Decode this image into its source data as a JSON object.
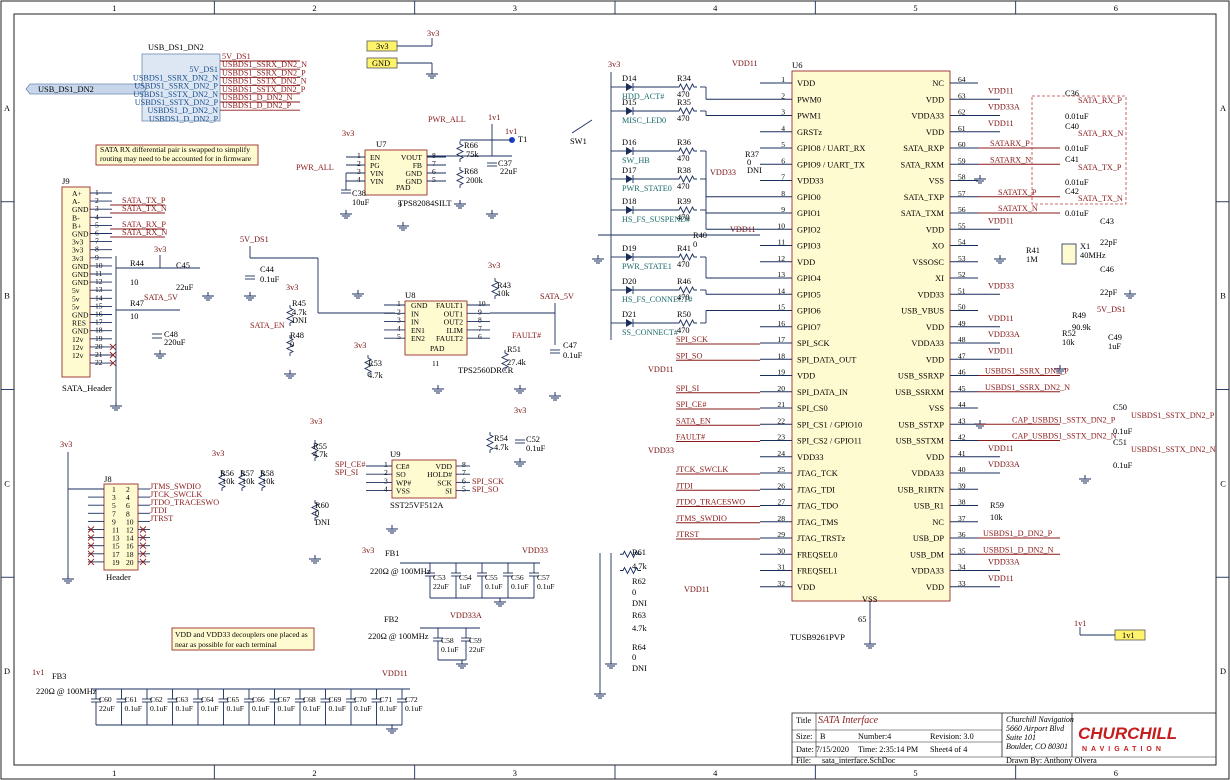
{
  "frame": {
    "col_labels": [
      "1",
      "2",
      "3",
      "4",
      "5",
      "6"
    ],
    "row_labels": [
      "A",
      "B",
      "C",
      "D"
    ]
  },
  "notes": {
    "sata_rx": [
      "SATA RX differential pair is swapped to simplify",
      "routing may need to be accounted for in firmware"
    ],
    "decoupling": [
      "VDD and VDD33 decouplers one placed as",
      "near as possible for each terminal"
    ]
  },
  "usb_harness": {
    "title": "USB_DS1_DN2",
    "port": "USB_DS1_DN2",
    "entries": [
      {
        "left": "",
        "right": "5V_DS1"
      },
      {
        "left": "5V_DS1",
        "right": "USBDS1_SSRX_DN2_N"
      },
      {
        "left": "USBDS1_SSRX_DN2_N",
        "right": "USBDS1_SSRX_DN2_P"
      },
      {
        "left": "USBDS1_SSRX_DN2_P",
        "right": "USBDS1_SSTX_DN2_N"
      },
      {
        "left": "USBDS1_SSTX_DN2_N",
        "right": "USBDS1_SSTX_DN2_P"
      },
      {
        "left": "USBDS1_SSTX_DN2_P",
        "right": "USBDS1_D_DN2_N"
      },
      {
        "left": "USBDS1_D_DN2_N",
        "right": "USBDS1_D_DN2_P"
      },
      {
        "left": "USBDS1_D_DN2_P",
        "right": ""
      }
    ]
  },
  "ports": {
    "p3v3": "3v3",
    "gnd": "GND",
    "p1v1": "1v1"
  },
  "power": {
    "v3v3": "3v3",
    "v1v1": "1v1",
    "vdd11": "VDD11",
    "vdd33": "VDD33",
    "vdd33a": "VDD33A",
    "v5ds1": "5V_DS1",
    "sata5v": "SATA_5V",
    "pwr_all": "PWR_ALL"
  },
  "j9": {
    "ref": "J9",
    "name": "SATA_Header",
    "pins": [
      "A+",
      "A-",
      "GND",
      "B-",
      "B+",
      "GND",
      "3v3",
      "3v3",
      "3v3",
      "GND",
      "GND",
      "GND",
      "5v",
      "5v",
      "5v",
      "GND",
      "RES",
      "GND",
      "12v",
      "12v",
      "12v"
    ],
    "nums": [
      "1",
      "2",
      "3",
      "4",
      "5",
      "6",
      "7",
      "8",
      "9",
      "10",
      "11",
      "12",
      "13",
      "14",
      "15",
      "16",
      "17",
      "18",
      "19",
      "20",
      "21",
      "22"
    ],
    "nets": [
      "SATA_TX_P",
      "SATA_TX_N",
      "SATA_RX_P",
      "SATA_RX_N"
    ],
    "r44": {
      "ref": "R44",
      "val": "10"
    },
    "r47": {
      "ref": "R47",
      "val": "10"
    },
    "c45": {
      "ref": "C45",
      "val": "22uF"
    },
    "c48": {
      "ref": "C48",
      "val": "220uF"
    }
  },
  "u7": {
    "ref": "U7",
    "name": "TPS82084SILT",
    "left": [
      "EN",
      "PG",
      "VIN",
      "VIN"
    ],
    "right": [
      "VOUT",
      "FB",
      "GND",
      "GND"
    ],
    "pad": "PAD",
    "lnums": [
      "1",
      "2",
      "3",
      "4"
    ],
    "rnums": [
      "8",
      "7",
      "6",
      "5"
    ],
    "padnum": "9",
    "r66": {
      "ref": "R66",
      "val": "75k"
    },
    "r68": {
      "ref": "R68",
      "val": "200k"
    },
    "c37": {
      "ref": "C37",
      "val": "22uF"
    },
    "c38": {
      "ref": "C38",
      "val": "10uF"
    },
    "t1": "T1"
  },
  "u8": {
    "ref": "U8",
    "name": "TPS2560DRCR",
    "left": [
      "GND",
      "IN",
      "IN",
      "EN1",
      "EN2"
    ],
    "right": [
      "FAULT1",
      "OUT1",
      "OUT2",
      "ILIM",
      "FAULT2"
    ],
    "pad": "PAD",
    "lnums": [
      "1",
      "2",
      "3",
      "4",
      "5"
    ],
    "rnums": [
      "10",
      "9",
      "8",
      "7",
      "6"
    ],
    "padnum": "11",
    "c44": {
      "ref": "C44",
      "val": "0.1uF"
    },
    "r45": {
      "ref": "R45",
      "val": "4.7k",
      "dni": "DNI"
    },
    "r48": {
      "ref": "R48",
      "val": "0"
    },
    "r43": {
      "ref": "R43",
      "val": "10k"
    },
    "r51": {
      "ref": "R51",
      "val": "27.4k"
    },
    "r53": {
      "ref": "R53",
      "val": "4.7k"
    },
    "c47": {
      "ref": "C47",
      "val": "0.1uF"
    },
    "sata_en": "SATA_EN",
    "fault": "FAULT#"
  },
  "j8": {
    "ref": "J8",
    "name": "Header",
    "nums_l": [
      "1",
      "3",
      "5",
      "7",
      "9",
      "11",
      "13",
      "15",
      "17",
      "19"
    ],
    "nums_r": [
      "2",
      "4",
      "6",
      "8",
      "10",
      "12",
      "14",
      "16",
      "18",
      "20"
    ],
    "nets": [
      "JTMS_SWDIO",
      "JTCK_SWCLK",
      "JTDO_TRACESWO",
      "JTDI",
      "JTRST"
    ],
    "r56": {
      "ref": "R56",
      "val": "10k"
    },
    "r57": {
      "ref": "R57",
      "val": "10k"
    },
    "r58": {
      "ref": "R58",
      "val": "10k"
    }
  },
  "u9": {
    "ref": "U9",
    "name": "SST25VF512A",
    "left": [
      "CE#",
      "SO",
      "WP#",
      "VSS"
    ],
    "right": [
      "VDD",
      "HOLD#",
      "SCK",
      "SI"
    ],
    "lnums": [
      "1",
      "2",
      "3",
      "4"
    ],
    "rnums": [
      "8",
      "7",
      "6",
      "5"
    ],
    "lnets": [
      "SPI_CE#",
      "SPI_SI"
    ],
    "rnets": [
      "SPI_SCK",
      "SPI_SO"
    ],
    "r55": {
      "ref": "R55",
      "val": "4.7k"
    },
    "r60": {
      "ref": "R60",
      "val": "0",
      "dni": "DNI"
    },
    "r54": {
      "ref": "R54",
      "val": "4.7k"
    },
    "c52": {
      "ref": "C52",
      "val": "0.1uF"
    }
  },
  "fb": {
    "fb1": {
      "ref": "FB1",
      "val": "220Ω @ 100MHz"
    },
    "fb2": {
      "ref": "FB2",
      "val": "220Ω @ 100MHz"
    },
    "fb3": {
      "ref": "FB3",
      "val": "220Ω @ 100MHz"
    },
    "caps1": [
      {
        "ref": "C53",
        "val": "22uF"
      },
      {
        "ref": "C54",
        "val": "1uF"
      },
      {
        "ref": "C55",
        "val": "0.1uF"
      },
      {
        "ref": "C56",
        "val": "0.1uF"
      },
      {
        "ref": "C57",
        "val": "0.1uF"
      }
    ],
    "caps2": [
      {
        "ref": "C58",
        "val": "0.1uF"
      },
      {
        "ref": "C59",
        "val": "22uF"
      }
    ],
    "caps3": [
      {
        "ref": "C60",
        "val": "22uF"
      },
      {
        "ref": "C61",
        "val": "0.1uF"
      },
      {
        "ref": "C62",
        "val": "0.1uF"
      },
      {
        "ref": "C63",
        "val": "0.1uF"
      },
      {
        "ref": "C64",
        "val": "0.1uF"
      },
      {
        "ref": "C65",
        "val": "0.1uF"
      },
      {
        "ref": "C66",
        "val": "0.1uF"
      },
      {
        "ref": "C67",
        "val": "0.1uF"
      },
      {
        "ref": "C68",
        "val": "0.1uF"
      },
      {
        "ref": "C69",
        "val": "0.1uF"
      },
      {
        "ref": "C70",
        "val": "0.1uF"
      },
      {
        "ref": "C71",
        "val": "0.1uF"
      },
      {
        "ref": "C72",
        "val": "0.1uF"
      }
    ]
  },
  "u6": {
    "ref": "U6",
    "name": "TUSB9261PVP",
    "left": [
      "VDD",
      "PWM0",
      "PWM1",
      "GRSTz",
      "GPIO8 / UART_RX",
      "GPIO9 / UART_TX",
      "VDD33",
      "GPIO0",
      "GPIO1",
      "GPIO2",
      "GPIO3",
      "VDD",
      "GPIO4",
      "GPIO5",
      "GPIO6",
      "GPIO7",
      "SPI_SCK",
      "SPI_DATA_OUT",
      "VDD",
      "SPI_DATA_IN",
      "SPI_CS0",
      "SPI_CS1 / GPIO10",
      "SPI_CS2 / GPIO11",
      "VDD33",
      "JTAG_TCK",
      "JTAG_TDI",
      "JTAG_TDO",
      "JTAG_TMS",
      "JTAG_TRSTz",
      "FREQSEL0",
      "FREQSEL1",
      "VDD"
    ],
    "right": [
      "NC",
      "VDD",
      "VDDA33",
      "VDD",
      "SATA_RXP",
      "SATA_RXM",
      "VSS",
      "SATA_TXP",
      "SATA_TXM",
      "VDD",
      "XO",
      "VSSOSC",
      "XI",
      "VDD33",
      "USB_VBUS",
      "VDD",
      "VDDA33",
      "VDD",
      "USB_SSRXP",
      "USB_SSRXM",
      "VSS",
      "USB_SSTXP",
      "USB_SSTXM",
      "VDD",
      "VDDA33",
      "USB_R1RTN",
      "USB_R1",
      "NC",
      "USB_DP",
      "USB_DM",
      "VDDA33",
      "VDD"
    ],
    "vss": "VSS",
    "vssnum": "65",
    "leds": [
      {
        "ref": "D14",
        "net": "HDD_ACT#",
        "r": "R34",
        "rv": "470"
      },
      {
        "ref": "D15",
        "net": "MISC_LED0",
        "r": "R35",
        "rv": "470"
      },
      {
        "ref": "D16",
        "net": "SW_HB",
        "r": "R36",
        "rv": "470"
      },
      {
        "ref": "D17",
        "net": "PWR_STATE0",
        "r": "R38",
        "rv": "470"
      },
      {
        "ref": "D18",
        "net": "HS_FS_SUSPEND#",
        "r": "R39",
        "rv": "470"
      },
      {
        "ref": "D19",
        "net": "PWR_STATE1",
        "r": "R41",
        "rv": "470"
      },
      {
        "ref": "D20",
        "net": "HS_FS_CONNECT#",
        "r": "R46",
        "rv": "470"
      },
      {
        "ref": "D21",
        "net": "SS_CONNECT#",
        "r": "R50",
        "rv": "470"
      }
    ],
    "lnets": [
      "SPI_SCK",
      "SPI_SO",
      "SPI_SI",
      "SPI_CE#",
      "SATA_EN",
      "FAULT#",
      "JTCK_SWCLK",
      "JTDI",
      "JTDO_TRACESWO",
      "JTMS_SWDIO",
      "JTRST"
    ],
    "sw1": "SW1",
    "r37": {
      "ref": "R37",
      "val": "0",
      "dni": "DNI"
    },
    "r40": {
      "ref": "R40",
      "val": "0"
    },
    "r61": {
      "ref": "R61",
      "val": "4.7k"
    },
    "r62": {
      "ref": "R62",
      "val": "0",
      "dni": "DNI"
    },
    "r63": {
      "ref": "R63",
      "val": "4.7k"
    },
    "r64": {
      "ref": "R64",
      "val": "0",
      "dni": "DNI"
    },
    "rnets": [
      "SATARX_P",
      "SATARX_N",
      "SATATX_P",
      "SATATX_N",
      "USBDS1_SSRX_DN2_P",
      "USBDS1_SSRX_DN2_N",
      "CAP_USBDS1_SSTX_DN2_P",
      "CAP_USBDS1_SSTX_DN2_N",
      "USBDS1_D_DN2_P",
      "USBDS1_D_DN2_N"
    ],
    "rcaps": [
      {
        "ref": "C36",
        "val": "0.01uF"
      },
      {
        "ref": "C40",
        "val": "0.01uF"
      },
      {
        "ref": "C41",
        "val": "0.01uF"
      },
      {
        "ref": "C42",
        "val": "0.01uF"
      }
    ],
    "sata_out": [
      "SATA_RX_P",
      "SATA_RX_N",
      "SATA_TX_P",
      "SATA_TX_N"
    ],
    "x1": {
      "ref": "X1",
      "val": "40MHz"
    },
    "c43": {
      "ref": "C43",
      "val": "22pF"
    },
    "c46": {
      "ref": "C46",
      "val": "22pF"
    },
    "r41": {
      "ref": "R41",
      "val": "1M"
    },
    "r49": {
      "ref": "R49",
      "val": "90.9k"
    },
    "r52": {
      "ref": "R52",
      "val": "10k"
    },
    "c49": {
      "ref": "C49",
      "val": "1uF"
    },
    "r59": {
      "ref": "R59",
      "val": "10k"
    },
    "c50": {
      "ref": "C50",
      "val": "0.1uF"
    },
    "c51": {
      "ref": "C51",
      "val": "0.1uF"
    },
    "usb_sstx": [
      "USBDS1_SSTX_DN2_P",
      "USBDS1_SSTX_DN2_N"
    ]
  },
  "title_block": {
    "title_lbl": "Title",
    "title": "SATA Interface",
    "size_lbl": "Size:",
    "size": "B",
    "number": "Number:4",
    "revision": "Revision:  3.0",
    "date": "Date:  7/15/2020",
    "time": "Time:  2:35:14 PM",
    "sheet": "Sheet4    of   4",
    "file_lbl": "File:",
    "file": "sata_interface.SchDoc",
    "company": [
      "Churchill Navigation",
      "5660 Airport Blvd",
      "Suite 101",
      "Boulder, CO 80301"
    ],
    "drawn": "Drawn By:  Anthony Olvera",
    "logo_top": "CHURCHILL",
    "logo_bottom": "NAVIGATION"
  }
}
